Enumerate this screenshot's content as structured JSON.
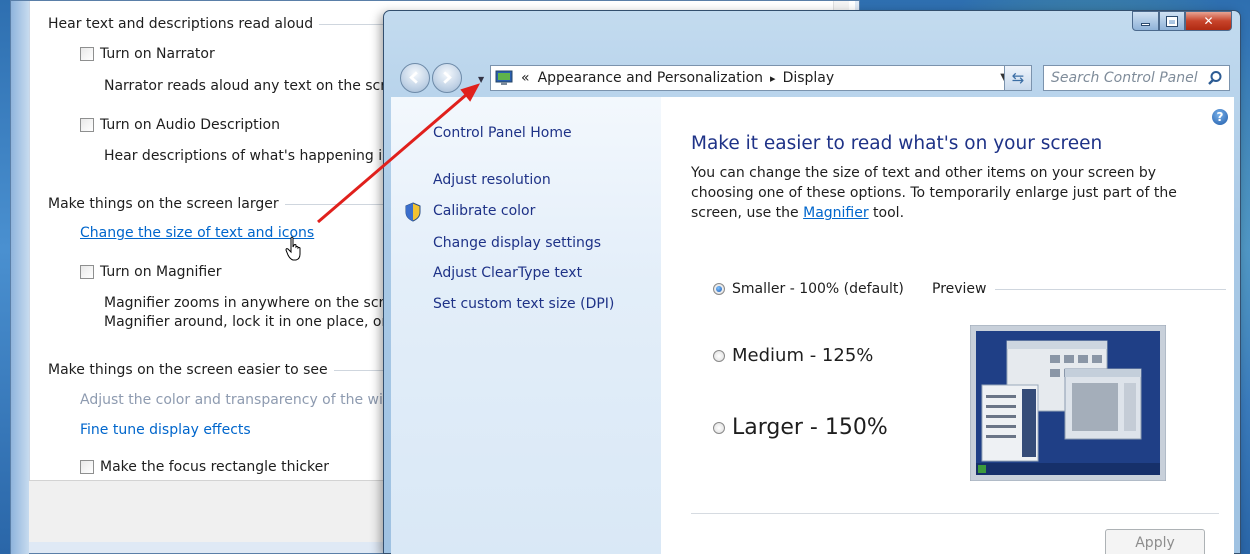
{
  "back_window": {
    "sections": [
      {
        "heading": "Hear text and descriptions read aloud"
      },
      {
        "heading": "Make things on the screen larger"
      },
      {
        "heading": "Make things on the screen easier to see"
      }
    ],
    "checkboxes": {
      "narrator": "Turn on Narrator",
      "audio_description": "Turn on Audio Description",
      "magnifier": "Turn on Magnifier",
      "focus_rectangle": "Make the focus rectangle thicker"
    },
    "descriptions": {
      "narrator": "Narrator reads aloud any text on the scre",
      "audio_description": "Hear descriptions of what's happening ir",
      "magnifier_1": "Magnifier zooms in anywhere on the scre",
      "magnifier_2": "Magnifier around, lock it in one place, or"
    },
    "links": {
      "change_size": "Change the size of text and icons",
      "adjust_color": "Adjust the color and transparency of the wir",
      "fine_tune": "Fine tune display effects"
    }
  },
  "front_window": {
    "address": {
      "chevron": "«",
      "crumb1": "Appearance and Personalization",
      "separator": "▸",
      "crumb2": "Display"
    },
    "search_placeholder": "Search Control Panel",
    "sidebar": {
      "home": "Control Panel Home",
      "items": [
        "Adjust resolution",
        "Calibrate color",
        "Change display settings",
        "Adjust ClearType text",
        "Set custom text size (DPI)"
      ]
    },
    "content": {
      "title": "Make it easier to read what's on your screen",
      "body_before_link": "You can change the size of text and other items on your screen by choosing one of these options. To temporarily enlarge just part of the screen, use the ",
      "body_link": "Magnifier",
      "body_after_link": " tool.",
      "options": [
        {
          "label": "Smaller - 100% (default)",
          "selected": true
        },
        {
          "label": "Medium - 125%",
          "selected": false
        },
        {
          "label": "Larger - 150%",
          "selected": false
        }
      ],
      "preview_label": "Preview",
      "apply_label": "Apply",
      "help_glyph": "?"
    }
  },
  "colors": {
    "link": "#0066cc",
    "title_blue": "#1e3287",
    "annotation_arrow": "#e0201c"
  }
}
